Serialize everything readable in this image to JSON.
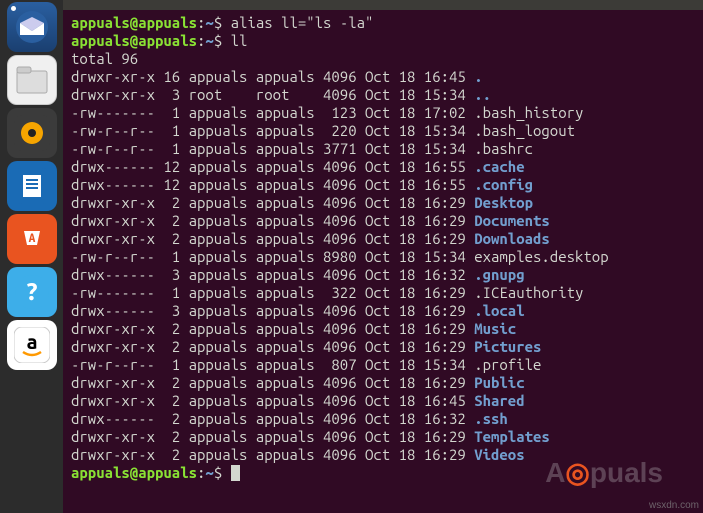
{
  "launcher": {
    "items": [
      {
        "name": "thunderbird",
        "glyph": "✉",
        "active": true
      },
      {
        "name": "files",
        "glyph": "📁",
        "active": false
      },
      {
        "name": "rhythmbox",
        "glyph": "◉",
        "active": false
      },
      {
        "name": "writer",
        "glyph": "📄",
        "active": false
      },
      {
        "name": "software",
        "glyph": "A",
        "active": false
      },
      {
        "name": "help",
        "glyph": "?",
        "active": false
      },
      {
        "name": "amazon",
        "glyph": "a",
        "active": false
      }
    ]
  },
  "prompt": {
    "user": "appuals",
    "host": "appuals",
    "path": "~",
    "symbol": "$"
  },
  "commands": [
    "alias ll=\"ls -la\"",
    "ll"
  ],
  "total_line": "total 96",
  "listing": [
    {
      "perm": "drwxr-xr-x",
      "links": "16",
      "owner": "appuals",
      "group": "appuals",
      "size": "4096",
      "date": "Oct 18 16:45",
      "name": ".",
      "type": "dir"
    },
    {
      "perm": "drwxr-xr-x",
      "links": " 3",
      "owner": "root   ",
      "group": "root   ",
      "size": "4096",
      "date": "Oct 18 15:34",
      "name": "..",
      "type": "dir"
    },
    {
      "perm": "-rw-------",
      "links": " 1",
      "owner": "appuals",
      "group": "appuals",
      "size": " 123",
      "date": "Oct 18 17:02",
      "name": ".bash_history",
      "type": "file"
    },
    {
      "perm": "-rw-r--r--",
      "links": " 1",
      "owner": "appuals",
      "group": "appuals",
      "size": " 220",
      "date": "Oct 18 15:34",
      "name": ".bash_logout",
      "type": "file"
    },
    {
      "perm": "-rw-r--r--",
      "links": " 1",
      "owner": "appuals",
      "group": "appuals",
      "size": "3771",
      "date": "Oct 18 15:34",
      "name": ".bashrc",
      "type": "file"
    },
    {
      "perm": "drwx------",
      "links": "12",
      "owner": "appuals",
      "group": "appuals",
      "size": "4096",
      "date": "Oct 18 16:55",
      "name": ".cache",
      "type": "dir"
    },
    {
      "perm": "drwx------",
      "links": "12",
      "owner": "appuals",
      "group": "appuals",
      "size": "4096",
      "date": "Oct 18 16:55",
      "name": ".config",
      "type": "dir"
    },
    {
      "perm": "drwxr-xr-x",
      "links": " 2",
      "owner": "appuals",
      "group": "appuals",
      "size": "4096",
      "date": "Oct 18 16:29",
      "name": "Desktop",
      "type": "dir"
    },
    {
      "perm": "drwxr-xr-x",
      "links": " 2",
      "owner": "appuals",
      "group": "appuals",
      "size": "4096",
      "date": "Oct 18 16:29",
      "name": "Documents",
      "type": "dir"
    },
    {
      "perm": "drwxr-xr-x",
      "links": " 2",
      "owner": "appuals",
      "group": "appuals",
      "size": "4096",
      "date": "Oct 18 16:29",
      "name": "Downloads",
      "type": "dir"
    },
    {
      "perm": "-rw-r--r--",
      "links": " 1",
      "owner": "appuals",
      "group": "appuals",
      "size": "8980",
      "date": "Oct 18 15:34",
      "name": "examples.desktop",
      "type": "file"
    },
    {
      "perm": "drwx------",
      "links": " 3",
      "owner": "appuals",
      "group": "appuals",
      "size": "4096",
      "date": "Oct 18 16:32",
      "name": ".gnupg",
      "type": "dir"
    },
    {
      "perm": "-rw-------",
      "links": " 1",
      "owner": "appuals",
      "group": "appuals",
      "size": " 322",
      "date": "Oct 18 16:29",
      "name": ".ICEauthority",
      "type": "file"
    },
    {
      "perm": "drwx------",
      "links": " 3",
      "owner": "appuals",
      "group": "appuals",
      "size": "4096",
      "date": "Oct 18 16:29",
      "name": ".local",
      "type": "dir"
    },
    {
      "perm": "drwxr-xr-x",
      "links": " 2",
      "owner": "appuals",
      "group": "appuals",
      "size": "4096",
      "date": "Oct 18 16:29",
      "name": "Music",
      "type": "dir"
    },
    {
      "perm": "drwxr-xr-x",
      "links": " 2",
      "owner": "appuals",
      "group": "appuals",
      "size": "4096",
      "date": "Oct 18 16:29",
      "name": "Pictures",
      "type": "dir"
    },
    {
      "perm": "-rw-r--r--",
      "links": " 1",
      "owner": "appuals",
      "group": "appuals",
      "size": " 807",
      "date": "Oct 18 15:34",
      "name": ".profile",
      "type": "file"
    },
    {
      "perm": "drwxr-xr-x",
      "links": " 2",
      "owner": "appuals",
      "group": "appuals",
      "size": "4096",
      "date": "Oct 18 16:29",
      "name": "Public",
      "type": "dir"
    },
    {
      "perm": "drwxr-xr-x",
      "links": " 2",
      "owner": "appuals",
      "group": "appuals",
      "size": "4096",
      "date": "Oct 18 16:45",
      "name": "Shared",
      "type": "dir"
    },
    {
      "perm": "drwx------",
      "links": " 2",
      "owner": "appuals",
      "group": "appuals",
      "size": "4096",
      "date": "Oct 18 16:32",
      "name": ".ssh",
      "type": "dir"
    },
    {
      "perm": "drwxr-xr-x",
      "links": " 2",
      "owner": "appuals",
      "group": "appuals",
      "size": "4096",
      "date": "Oct 18 16:29",
      "name": "Templates",
      "type": "dir"
    },
    {
      "perm": "drwxr-xr-x",
      "links": " 2",
      "owner": "appuals",
      "group": "appuals",
      "size": "4096",
      "date": "Oct 18 16:29",
      "name": "Videos",
      "type": "dir"
    }
  ],
  "watermark": "wsxdn.com",
  "logo_text": "A@puals"
}
